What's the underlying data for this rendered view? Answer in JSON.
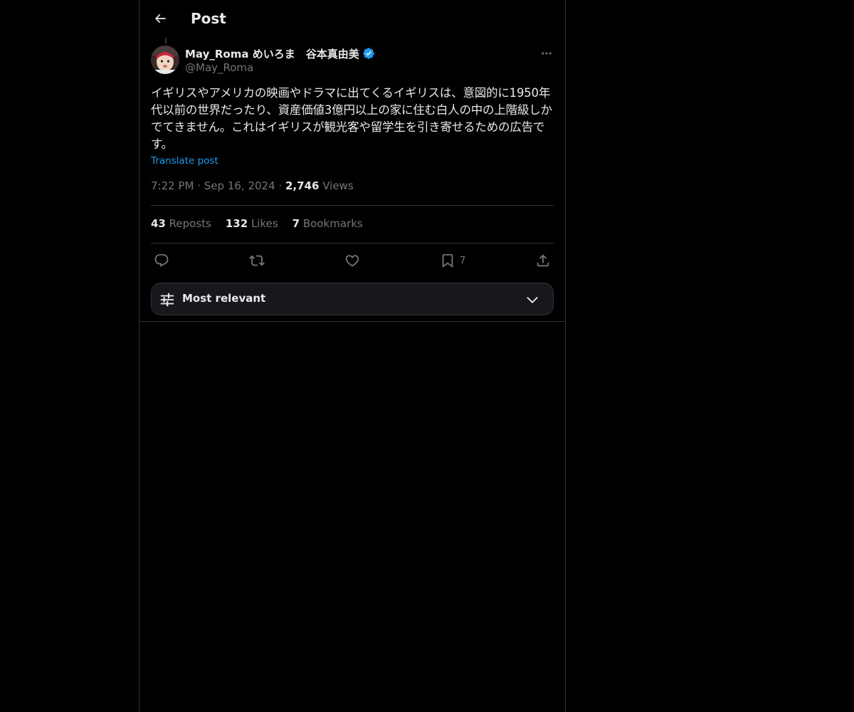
{
  "header": {
    "title": "Post",
    "back_icon": "arrow-left-icon"
  },
  "author": {
    "display_name": "May_Roma めいろま　谷本真由美",
    "handle": "@May_Roma",
    "verified": true,
    "verified_color": "#1d9bf0"
  },
  "post": {
    "text": "イギリスやアメリカの映画やドラマに出てくるイギリスは、意図的に1950年代以前の世界だったり、資産価値3億円以上の家に住む白人の中の上階級しかでてきません。これはイギリスが観光客や留学生を引き寄せるための広告です。",
    "translate_label": "Translate post",
    "time": "7:22 PM",
    "date": "Sep 16, 2024",
    "separator": "·",
    "views_count": "2,746",
    "views_label": "Views"
  },
  "stats": {
    "reposts_count": "43",
    "reposts_label": "Reposts",
    "likes_count": "132",
    "likes_label": "Likes",
    "bookmarks_count": "7",
    "bookmarks_label": "Bookmarks"
  },
  "actions": {
    "reply_icon": "reply-icon",
    "repost_icon": "repost-icon",
    "like_icon": "heart-icon",
    "bookmark_icon": "bookmark-icon",
    "bookmark_count": "7",
    "share_icon": "share-icon"
  },
  "sort": {
    "label": "Most relevant",
    "icon": "sliders-icon",
    "chevron": "chevron-down-icon"
  },
  "colors": {
    "background": "#000000",
    "text_primary": "#e7e9ea",
    "text_secondary": "#71767b",
    "border": "#2f3336",
    "accent": "#1d9bf0"
  }
}
